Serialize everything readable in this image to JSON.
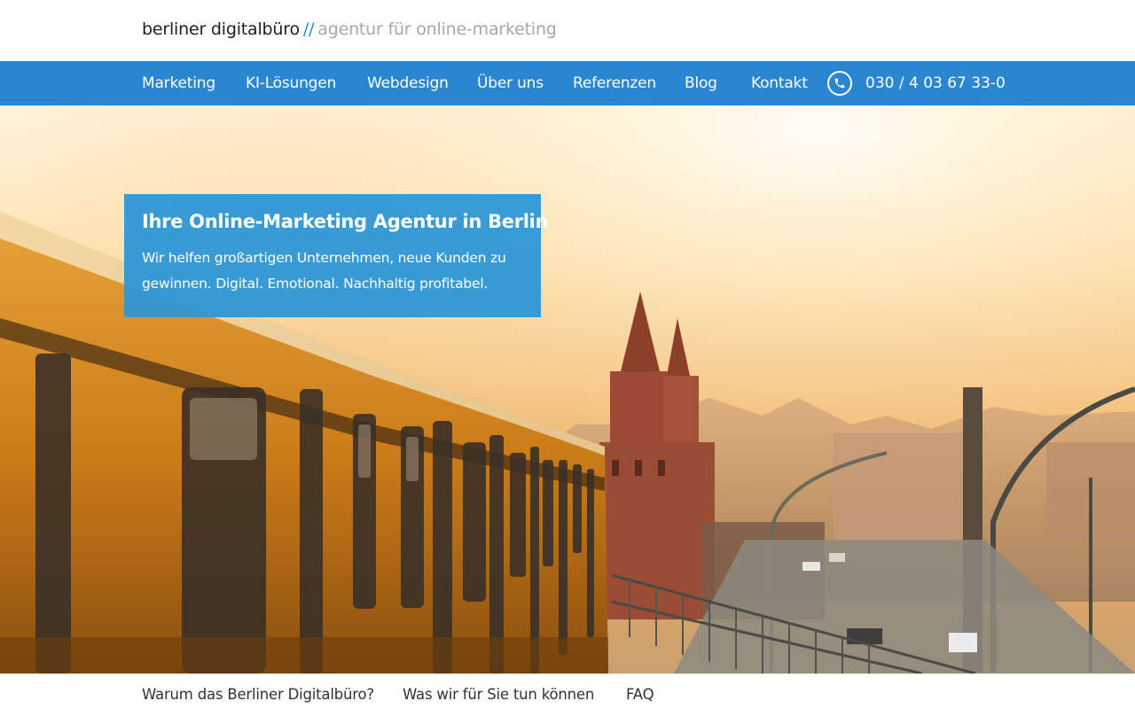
{
  "header": {
    "brand": "berliner digitalbüro",
    "separator": "//",
    "tagline": "agentur für online-marketing"
  },
  "nav": {
    "items": [
      {
        "label": "Marketing"
      },
      {
        "label": "KI-Lösungen"
      },
      {
        "label": "Webdesign"
      },
      {
        "label": "Über uns"
      },
      {
        "label": "Referenzen"
      },
      {
        "label": "Blog"
      },
      {
        "label": "Kontakt"
      }
    ],
    "phone_icon": "phone-icon",
    "phone": "030 / 4 03 67 33-0"
  },
  "hero": {
    "title": "Ihre Online-Marketing Agentur in Berlin",
    "subtitle": "Wir helfen großartigen Unternehmen, neue Kunden zu gewinnen. Digital. Emotional. Nachhaltig profitabel."
  },
  "subnav": {
    "items": [
      {
        "label": "Warum das Berliner Digitalbüro?"
      },
      {
        "label": "Was wir für Sie tun können"
      },
      {
        "label": "FAQ"
      }
    ]
  },
  "colors": {
    "accent": "#2a86d0",
    "hero_box": "#2a96d7",
    "tagline": "#a8a8a8"
  }
}
